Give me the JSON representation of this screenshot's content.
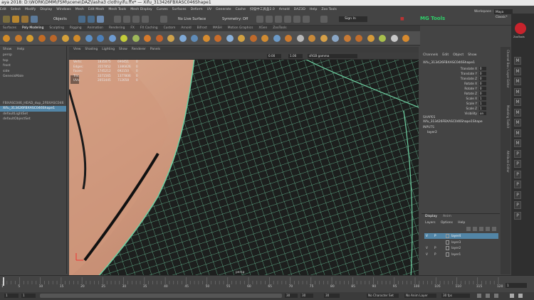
{
  "window_title": "aya 2018: D:\\WORK\\DMM\\FSM\\scene\\DAZ\\lasha3 cloth\\yifu.ffx* — Xifu_313426FBXASC046Shape1",
  "menu": [
    "Edit",
    "Select",
    "Modify",
    "Display",
    "Windows",
    "Mesh",
    "Edit Mesh",
    "Mesh Tools",
    "Mesh Display",
    "Curves",
    "Surfaces",
    "Deform",
    "UV",
    "Generate",
    "Cache",
    "扫描中工具盒2.0",
    "Arnold",
    "DAZ3D",
    "Help",
    "Zoo Tools"
  ],
  "status": {
    "objects_label": "Objects",
    "live_surface": "No Live Surface",
    "symmetry": "Symmetry: Off",
    "sign_in": "Sign In",
    "workspace_label": "Workspace :",
    "workspace_value": "Maya Classic*",
    "mg_tools": "MG Tools"
  },
  "shelf_tabs": [
    "Surfaces",
    "Poly Modeling",
    "Sculpting",
    "Rigging",
    "Animation",
    "Rendering",
    "FX",
    "FX Caching",
    "Custom",
    "Arnold",
    "Bifrost",
    "MASH",
    "Motion Graphics",
    "XGen",
    "ZooTools"
  ],
  "active_shelf_tab": "Poly Modeling",
  "outliner": {
    "menu": [
      "Show",
      "Help"
    ],
    "items": [
      "persp",
      "top",
      "front",
      "side",
      "GenesisMale",
      "",
      "",
      "",
      "",
      "FBXASC046_HEAD_dup_2FBXASC046",
      "Xifu_313426FBXASC046Shape1",
      "defaultLightSet",
      "defaultObjectSet"
    ],
    "selected_index": 10
  },
  "viewport": {
    "menu": [
      "View",
      "Shading",
      "Lighting",
      "Show",
      "Renderer",
      "Panels"
    ],
    "exposure": "0.00",
    "gamma": "1.00",
    "colorspace": "sRGB gamma",
    "stats": [
      [
        "Verts:",
        "1835075",
        "696451",
        "0"
      ],
      [
        "Edges:",
        "3557852",
        "1386826",
        "0"
      ],
      [
        "Faces:",
        "1745212",
        "692150",
        "0"
      ],
      [
        "Tris:",
        "3371565",
        "1377806",
        "0"
      ],
      [
        "UVs:",
        "2051445",
        "712658",
        "0"
      ]
    ],
    "camera": "persp"
  },
  "channel_box": {
    "menu": [
      "Channels",
      "Edit",
      "Object",
      "Show"
    ],
    "object": "Xifu_313426FBXASC046Shape1",
    "attributes": [
      [
        "Translate X",
        "0"
      ],
      [
        "Translate Y",
        "0"
      ],
      [
        "Translate Z",
        "0"
      ],
      [
        "Rotate X",
        "0"
      ],
      [
        "Rotate Y",
        "0"
      ],
      [
        "Rotate Z",
        "0"
      ],
      [
        "Scale X",
        "1"
      ],
      [
        "Scale Y",
        "1"
      ],
      [
        "Scale Z",
        "1"
      ],
      [
        "Visibility",
        "on"
      ]
    ],
    "shapes_header": "SHAPES",
    "shape_name": "Xifu_313426FBXASC046Shape1Shape",
    "inputs_header": "INPUTS",
    "input_name": "layer2"
  },
  "layers": {
    "tabs": [
      "Display",
      "Anim"
    ],
    "menu": [
      "Layers",
      "Options",
      "Help"
    ],
    "rows": [
      {
        "v": "V",
        "p": "P",
        "name": "layer4",
        "sel": true
      },
      {
        "v": "",
        "p": "",
        "name": "layer3",
        "sel": false
      },
      {
        "v": "V",
        "p": "P",
        "name": "layer2",
        "sel": false
      },
      {
        "v": "V",
        "p": "P",
        "name": "layer1",
        "sel": false
      }
    ]
  },
  "side_tabs": [
    "Channel Box / Layer Editor",
    "Modeling Toolkit",
    "Attribute Editor"
  ],
  "far_right": {
    "brand": "ZooTools",
    "labels": [
      "M",
      "M",
      "M",
      "M",
      "M",
      "M",
      "M",
      "M",
      "M",
      "P",
      "P",
      "P",
      "P",
      "P",
      "P",
      "P"
    ]
  },
  "timeline": {
    "ticks": [
      "1",
      "5",
      "10",
      "15",
      "20",
      "25",
      "30",
      "35",
      "40",
      "45",
      "50",
      "55",
      "60",
      "65",
      "70",
      "75",
      "80",
      "85",
      "90",
      "95",
      "100",
      "105",
      "110",
      "115",
      "120"
    ],
    "current": "1",
    "start": "1",
    "start2": "1",
    "end": "30",
    "end2": "30",
    "end3": "30",
    "character_set": "No Character Set",
    "anim_layer": "No Anim Layer",
    "fps": "30 fps"
  }
}
